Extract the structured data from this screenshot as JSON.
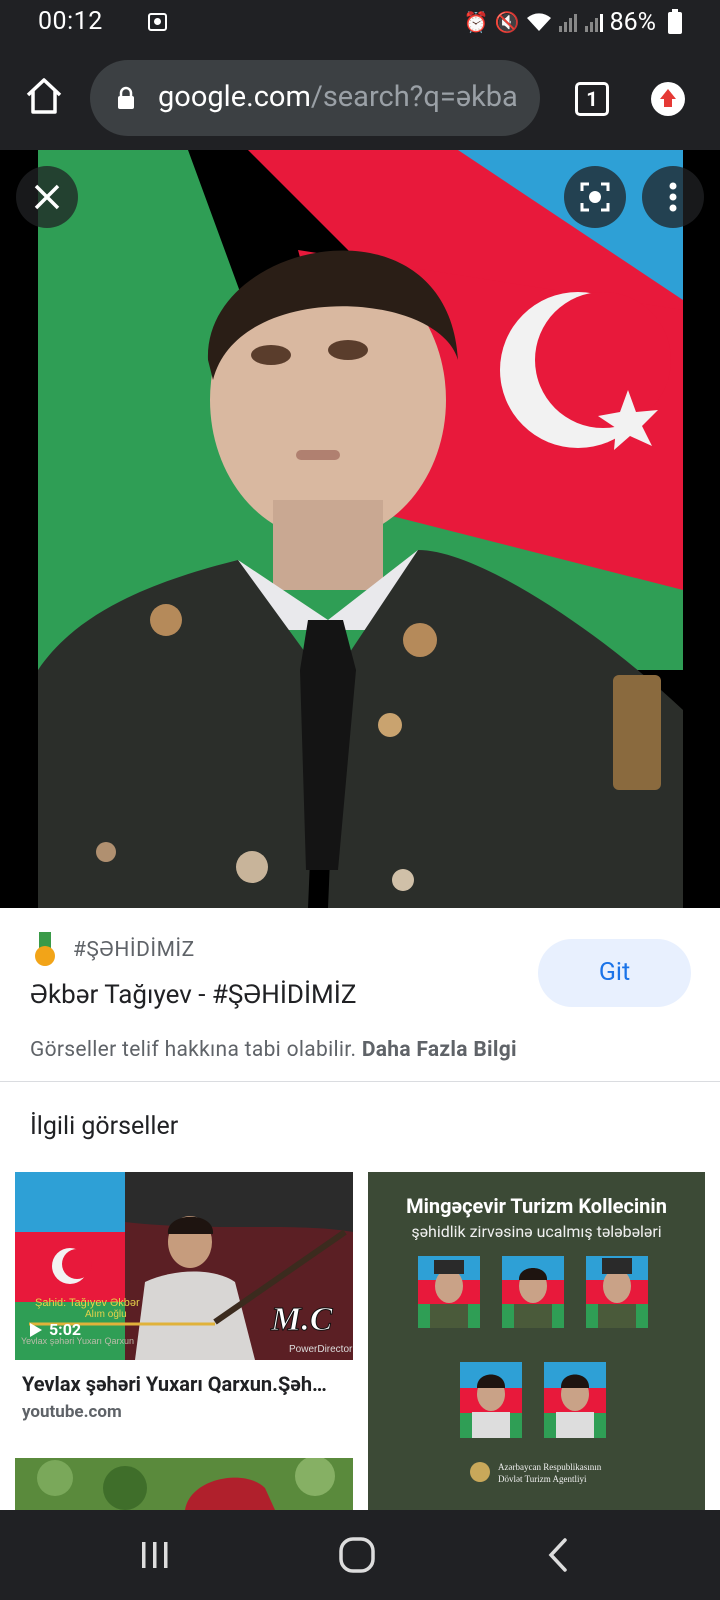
{
  "status_bar": {
    "time": "00:12",
    "battery": "86%",
    "icons": [
      "screen-recorder-icon",
      "alarm-icon",
      "mute-icon",
      "wifi-icon",
      "signal-icon",
      "signal-icon",
      "battery-icon"
    ]
  },
  "browser": {
    "url_domain": "google.com",
    "url_path": "/search?q=əkba",
    "tab_count": "1",
    "icons": [
      "home-icon",
      "lock-icon",
      "tab-switcher-icon",
      "update-icon"
    ]
  },
  "viewer": {
    "icons": [
      "close-icon",
      "lens-icon",
      "more-vert-icon"
    ]
  },
  "info": {
    "source_name": "#ŞƏHİDİMİZ",
    "title": "Əkbər Tağıyev - #ŞƏHİDİMİZ",
    "copyright_text": "Görseller telif hakkına tabi olabilir.",
    "learn_more": "Daha Fazla Bilgi",
    "visit_label": "Git"
  },
  "related": {
    "heading": "İlgili görseller",
    "items": [
      {
        "caption": "Yevlax şəhəri Yuxarı Qarxun.Şəh…",
        "source": "youtube.com",
        "duration": "5:02",
        "thumb_text_1": "Şahid: Tağıyev Əkbər",
        "thumb_text_2": "Alım oğlu",
        "thumb_text_3": "Yevlax şəhəri Yuxarı Qarxun",
        "watermark": "M.C",
        "watermark_sub": "PowerDirector"
      },
      {
        "title": "Mingəçevir Turizm Kollecinin",
        "subtitle": "şəhidlik zirvəsinə ucalmış tələbələri",
        "footer_1": "Azərbaycan Respublikasının",
        "footer_2": "Dövlət Turizm Agentliyi"
      }
    ]
  },
  "nav": {
    "icons": [
      "recents-icon",
      "home-nav-icon",
      "back-icon"
    ]
  },
  "colors": {
    "dark_bg": "#202124",
    "url_bar": "#3c4043",
    "accent": "#1a73e8",
    "flag_blue": "#2ea0d6",
    "flag_red": "#e8193b",
    "flag_green": "#2f9e55"
  }
}
